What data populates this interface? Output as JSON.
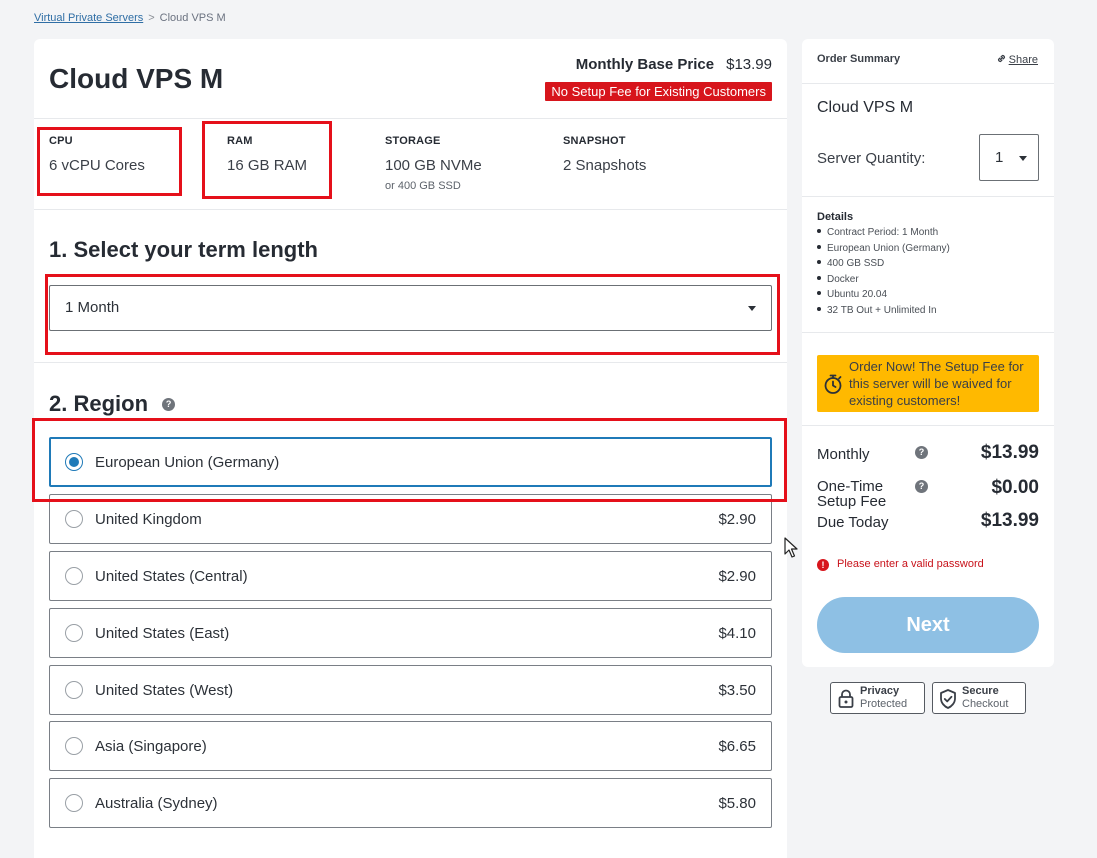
{
  "breadcrumb": {
    "link": "Virtual Private Servers",
    "separator": ">",
    "current": "Cloud VPS M"
  },
  "product": {
    "title": "Cloud VPS M",
    "price_label": "Monthly Base Price",
    "price": "$13.99",
    "setup_badge": "No Setup Fee for Existing Customers"
  },
  "specs": [
    {
      "label": "CPU",
      "value": "6 vCPU Cores",
      "sub": ""
    },
    {
      "label": "RAM",
      "value": "16 GB RAM",
      "sub": ""
    },
    {
      "label": "STORAGE",
      "value": "100 GB NVMe",
      "sub": "or 400 GB SSD"
    },
    {
      "label": "SNAPSHOT",
      "value": "2 Snapshots",
      "sub": ""
    }
  ],
  "term": {
    "title": "1. Select your term length",
    "selected": "1 Month"
  },
  "region": {
    "title": "2. Region",
    "help": "?",
    "options": [
      {
        "name": "European Union (Germany)",
        "price": "",
        "selected": true
      },
      {
        "name": "United Kingdom",
        "price": "$2.90",
        "selected": false
      },
      {
        "name": "United States (Central)",
        "price": "$2.90",
        "selected": false
      },
      {
        "name": "United States (East)",
        "price": "$4.10",
        "selected": false
      },
      {
        "name": "United States (West)",
        "price": "$3.50",
        "selected": false
      },
      {
        "name": "Asia (Singapore)",
        "price": "$6.65",
        "selected": false
      },
      {
        "name": "Australia (Sydney)",
        "price": "$5.80",
        "selected": false
      }
    ]
  },
  "summary": {
    "heading": "Order Summary",
    "share": "Share",
    "title": "Cloud VPS M",
    "qty_label": "Server Quantity:",
    "qty_value": "1",
    "details_heading": "Details",
    "details": [
      "Contract Period: 1 Month",
      "European Union (Germany)",
      "400 GB SSD",
      "Docker",
      "Ubuntu 20.04",
      "32 TB Out + Unlimited In"
    ],
    "notice": "Order Now! The Setup Fee for this server will be waived for existing customers!",
    "monthly_label": "Monthly",
    "monthly_value": "$13.99",
    "setup_label_1": "One-Time",
    "setup_label_2": "Setup Fee",
    "setup_value": "$0.00",
    "due_label": "Due Today",
    "due_value": "$13.99",
    "error": "Please enter a valid password",
    "next": "Next"
  },
  "badges": {
    "privacy_1": "Privacy",
    "privacy_2": "Protected",
    "secure_1": "Secure",
    "secure_2": "Checkout"
  },
  "colors": {
    "accent": "#1f7ab8",
    "badge_red": "#d7151c",
    "notice": "#ffb900",
    "next_disabled": "#8ec0e4",
    "highlight": "#e5101a"
  }
}
